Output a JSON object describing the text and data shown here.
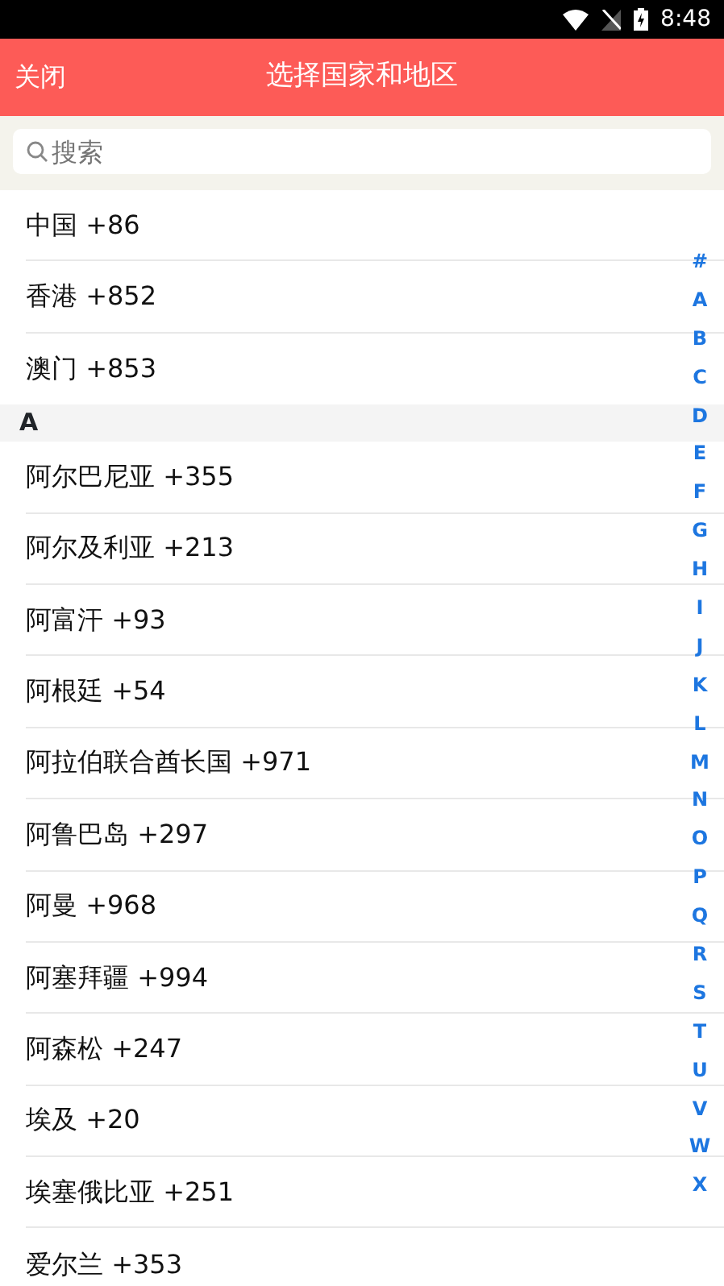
{
  "status_bar": {
    "time": "8:48"
  },
  "header": {
    "close": "关闭",
    "title": "选择国家和地区"
  },
  "search": {
    "placeholder": "搜索"
  },
  "list": [
    {
      "kind": "row",
      "text": "中国 +86"
    },
    {
      "kind": "row",
      "text": "香港 +852"
    },
    {
      "kind": "row",
      "text": "澳门 +853"
    },
    {
      "kind": "section",
      "text": "A"
    },
    {
      "kind": "row",
      "text": "阿尔巴尼亚 +355"
    },
    {
      "kind": "row",
      "text": "阿尔及利亚 +213"
    },
    {
      "kind": "row",
      "text": "阿富汗 +93"
    },
    {
      "kind": "row",
      "text": "阿根廷 +54"
    },
    {
      "kind": "row",
      "text": "阿拉伯联合酋长国 +971"
    },
    {
      "kind": "row",
      "text": "阿鲁巴岛 +297"
    },
    {
      "kind": "row",
      "text": "阿曼 +968"
    },
    {
      "kind": "row",
      "text": "阿塞拜疆 +994"
    },
    {
      "kind": "row",
      "text": "阿森松 +247"
    },
    {
      "kind": "row",
      "text": "埃及 +20"
    },
    {
      "kind": "row",
      "text": "埃塞俄比亚 +251"
    },
    {
      "kind": "row",
      "text": "爱尔兰 +353"
    }
  ],
  "index": [
    "#",
    "A",
    "B",
    "C",
    "D",
    "E",
    "F",
    "G",
    "H",
    "I",
    "J",
    "K",
    "L",
    "M",
    "N",
    "O",
    "P",
    "Q",
    "R",
    "S",
    "T",
    "U",
    "V",
    "W",
    "X"
  ]
}
